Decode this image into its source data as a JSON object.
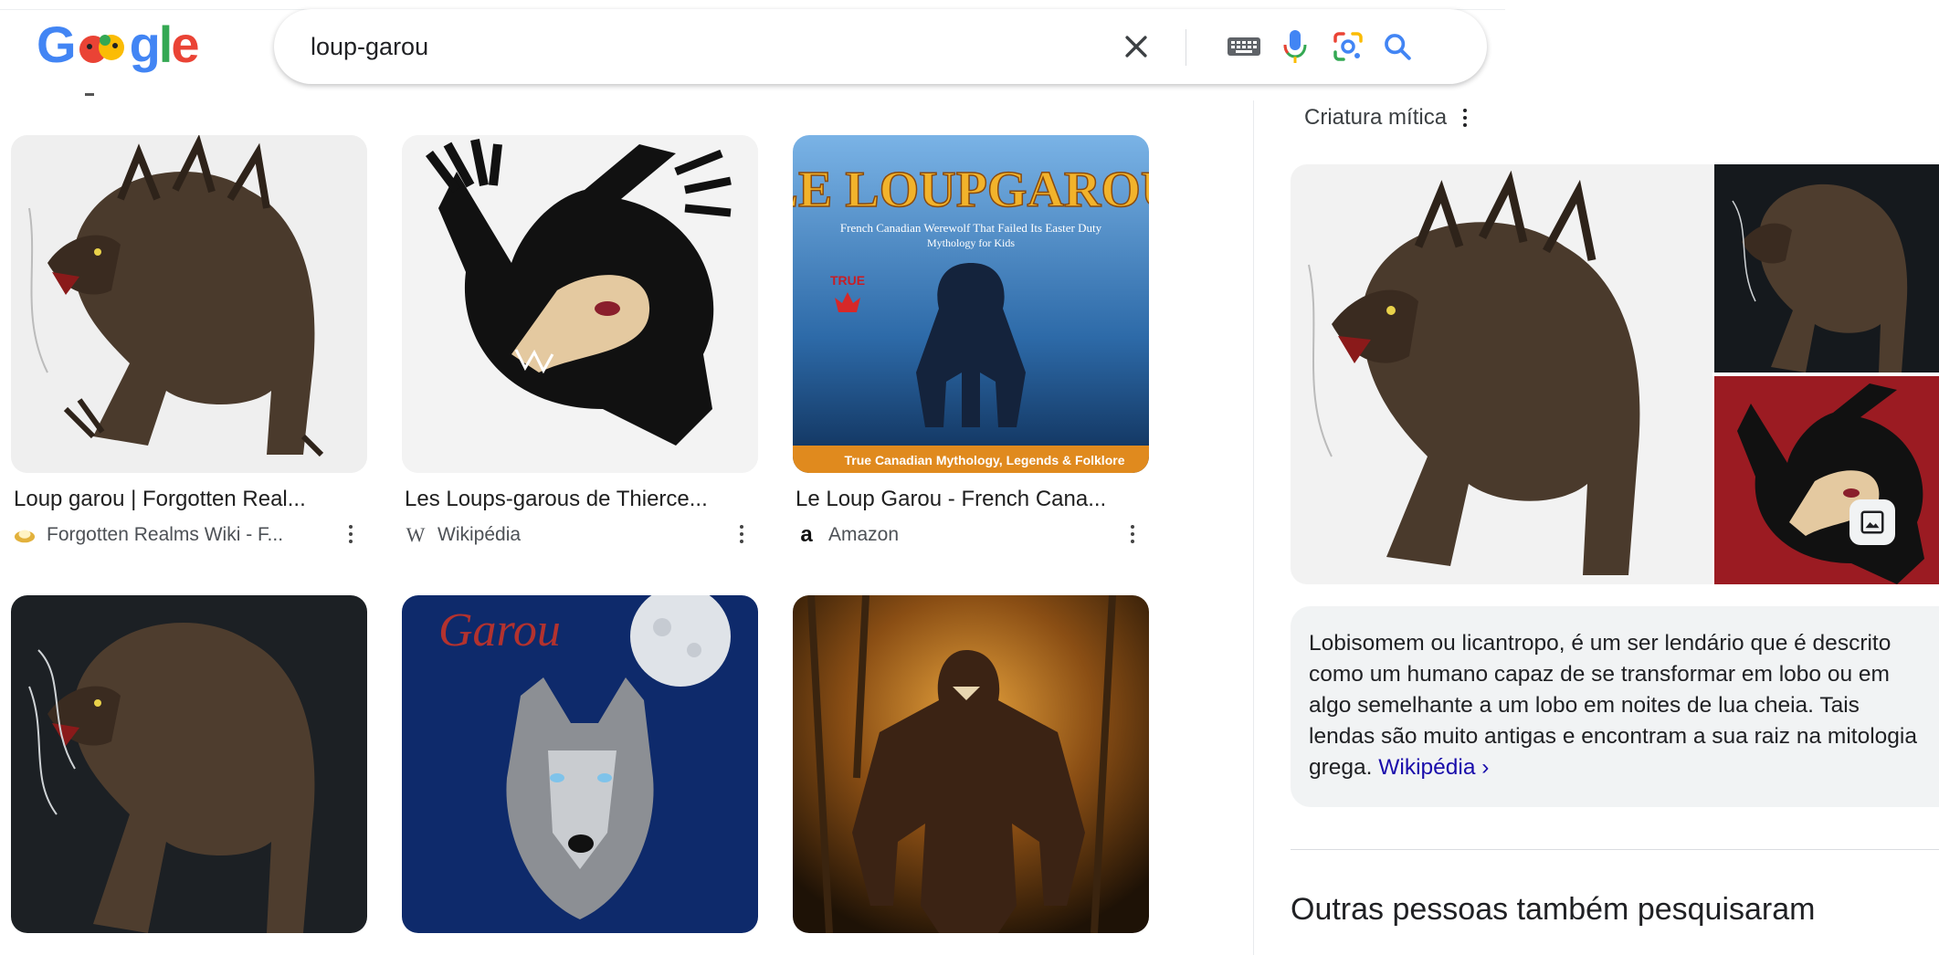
{
  "header": {
    "logo_text": "Google",
    "search": {
      "query": "loup-garou"
    },
    "icons": [
      "close-icon",
      "keyboard-icon",
      "microphone-icon",
      "google-lens-icon",
      "search-icon"
    ]
  },
  "results": [
    {
      "title": "Loup garou | Forgotten Real...",
      "source": "Forgotten Realms Wiki - F...",
      "source_icon": "forgotten-realms-icon"
    },
    {
      "title": "Les Loups-garous de Thierce...",
      "source": "Wikipédia",
      "source_icon": "wikipedia-icon"
    },
    {
      "title": "Le Loup Garou - French Cana...",
      "source": "Amazon",
      "source_icon": "amazon-icon"
    },
    {
      "title": "",
      "source": ""
    },
    {
      "title": "",
      "source": ""
    },
    {
      "title": "",
      "source": ""
    }
  ],
  "book_cover": {
    "title": "LE LOUPGAROU",
    "subtitle": "French Canadian Werewolf That Failed Its Easter Duty",
    "subtitle2": "Mythology for Kids",
    "badge": "TRUE",
    "footer": "True Canadian Mythology, Legends & Folklore"
  },
  "poster_text": "Garou",
  "knowledge_panel": {
    "type": "Criatura mítica",
    "description": "Lobisomem ou licantropo, é um ser lendário que é descrito como um humano capaz de se transformar em lobo ou em algo semelhante a um lobo em noites de lua cheia. Tais lendas são muito antigas e encontram a sua raiz na mitologia grega.",
    "source_link": "Wikipédia ›",
    "related_heading": "Outras pessoas também pesquisaram"
  },
  "colors": {
    "google_blue": "#4285f4",
    "google_red": "#ea4335",
    "google_yellow": "#fbbc05",
    "google_green": "#34a853",
    "link": "#1a0dab",
    "panel_bg": "#f1f3f4"
  }
}
